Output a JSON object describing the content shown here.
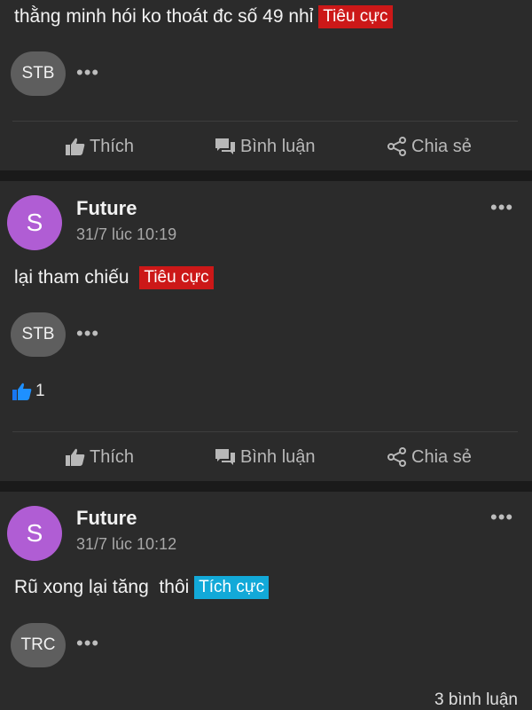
{
  "actions": {
    "like": "Thích",
    "comment": "Bình luận",
    "share": "Chia sẻ"
  },
  "colors": {
    "negative_tag": "#cc1818",
    "positive_tag": "#12a9d8",
    "avatar": "#b05dd4",
    "like_blue": "#1877f2"
  },
  "icons": [
    "thumbs-up-icon",
    "comment-icon",
    "share-icon",
    "more-dots-icon"
  ],
  "post1": {
    "text": "thằng minh hói ko thoát đc số 49 nhỉ",
    "tag": "Tiêu cực",
    "ticker": "STB",
    "more": "•••"
  },
  "post2": {
    "avatar_letter": "S",
    "author": "Future",
    "time": "31/7 lúc 10:19",
    "text": "lại tham chiếu",
    "tag": "Tiêu cực",
    "ticker": "STB",
    "more": "•••",
    "menu": "•••",
    "likes": "1"
  },
  "post3": {
    "avatar_letter": "S",
    "author": "Future",
    "time": "31/7 lúc 10:12",
    "text": "Rũ xong lại tăng  thôi",
    "tag": "Tích cực",
    "ticker": "TRC",
    "more": "•••",
    "menu": "•••",
    "comments": "3 bình luận"
  }
}
